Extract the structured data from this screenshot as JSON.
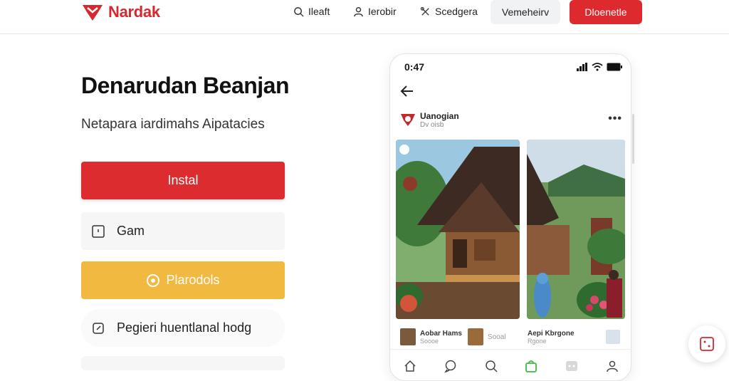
{
  "brand": {
    "name": "Nardak",
    "accent": "#d7282f"
  },
  "nav": {
    "items": [
      {
        "label": "Ileaft",
        "icon": "search-icon"
      },
      {
        "label": "Ierobir",
        "icon": "user-icon"
      },
      {
        "label": "Scedgera",
        "icon": "tools-icon"
      }
    ],
    "secondary_button": "Vemeheirv",
    "primary_button": "Dloenetle"
  },
  "hero": {
    "headline": "Denarudan Beanjan",
    "subline": "Netapara iardimahs Aipatacies"
  },
  "actions": {
    "install": "Instal",
    "gam": "Gam",
    "yellow": "Plarodols",
    "link": "Pegieri huentlanal hodg"
  },
  "phone": {
    "time": "0:47",
    "post": {
      "name": "Uanogian",
      "sub": "Dv oisb"
    },
    "captions": [
      {
        "title": "Aobar Hams",
        "sub": "Soooe"
      },
      {
        "title": "Sooal",
        "sub": ""
      }
    ],
    "caption_b": "Aepi Kbrgone",
    "caption_b_sub": "Rgone",
    "tabs": [
      "home-icon",
      "chat-icon",
      "search-icon",
      "bag-icon",
      "game-icon",
      "profile-icon"
    ]
  },
  "colors": {
    "red": "#dd2c2f",
    "yellow": "#f1b93f",
    "green": "#3fb93f"
  }
}
